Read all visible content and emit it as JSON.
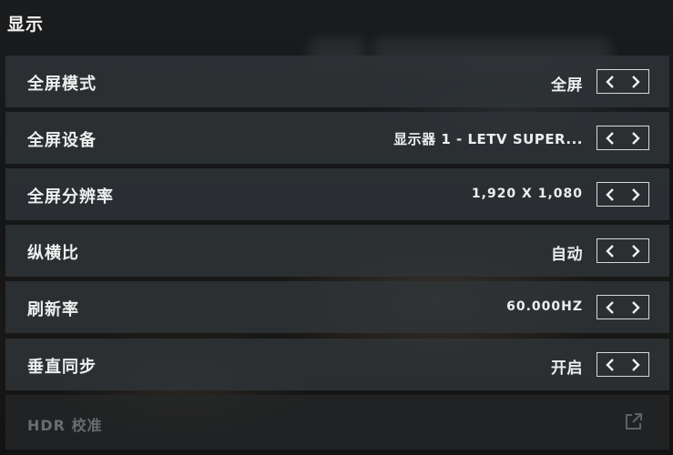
{
  "section": {
    "title": "显示"
  },
  "rows": [
    {
      "label": "全屏模式",
      "value": "全屏"
    },
    {
      "label": "全屏设备",
      "value": "显示器 1 - LETV SUPER..."
    },
    {
      "label": "全屏分辨率",
      "value": "1,920 X 1,080"
    },
    {
      "label": "纵横比",
      "value": "自动"
    },
    {
      "label": "刷新率",
      "value": "60.000HZ"
    },
    {
      "label": "垂直同步",
      "value": "开启"
    },
    {
      "label": "HDR 校准",
      "value": ""
    }
  ],
  "icons": {
    "prev": "chevron-left-icon",
    "next": "chevron-right-icon",
    "external": "external-link-icon"
  },
  "colors": {
    "row_bg": "#303438",
    "text": "#eeeeee",
    "disabled_text": "#6a6c6e",
    "stepper_border": "#d8d8d8"
  }
}
